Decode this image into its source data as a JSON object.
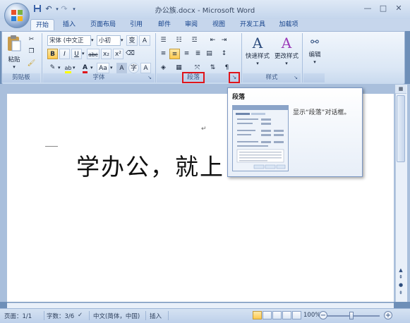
{
  "title_bar": {
    "document_title": "办公族.docx - Microsoft Word",
    "save_icon": "save-icon",
    "undo_icon": "undo-icon",
    "redo_icon": "redo-icon",
    "customize_icon": "customize-toolbar-icon",
    "minimize": "—",
    "maximize": "□",
    "close": "✕"
  },
  "tabs": [
    {
      "label": "开始",
      "active": true
    },
    {
      "label": "插入"
    },
    {
      "label": "页面布局"
    },
    {
      "label": "引用"
    },
    {
      "label": "邮件"
    },
    {
      "label": "审阅"
    },
    {
      "label": "视图"
    },
    {
      "label": "开发工具"
    },
    {
      "label": "加载项"
    }
  ],
  "ribbon": {
    "clipboard": {
      "paste_label": "粘贴",
      "group_label": "剪贴板"
    },
    "font": {
      "font_name": "宋体 (中文正",
      "font_size": "小初",
      "group_label": "字体",
      "bold": "B",
      "italic": "I",
      "underline": "U",
      "strikethrough": "abc",
      "subscript": "x₂",
      "superscript": "x²",
      "change_case": "Aa",
      "font_color": "A",
      "highlight": "ab",
      "char_border": "A",
      "enclose": "字"
    },
    "paragraph": {
      "group_label": "段落"
    },
    "styles": {
      "quick_styles": "快速样式",
      "change_styles": "更改样式",
      "group_label": "样式"
    },
    "editing": {
      "label": "编辑"
    }
  },
  "document": {
    "text": "学办公，就上"
  },
  "tooltip": {
    "title": "段落",
    "description": "显示“段落”对话框。"
  },
  "status_bar": {
    "page": "页面：1/1",
    "words": "字数：3/6",
    "language": "中文(简体，中国)",
    "insert_mode": "插入",
    "zoom": "100%"
  },
  "colors": {
    "highlight_red": "#e0141b",
    "ribbon_blue": "#dbe7f5",
    "frame_blue": "#6e8fb8"
  }
}
